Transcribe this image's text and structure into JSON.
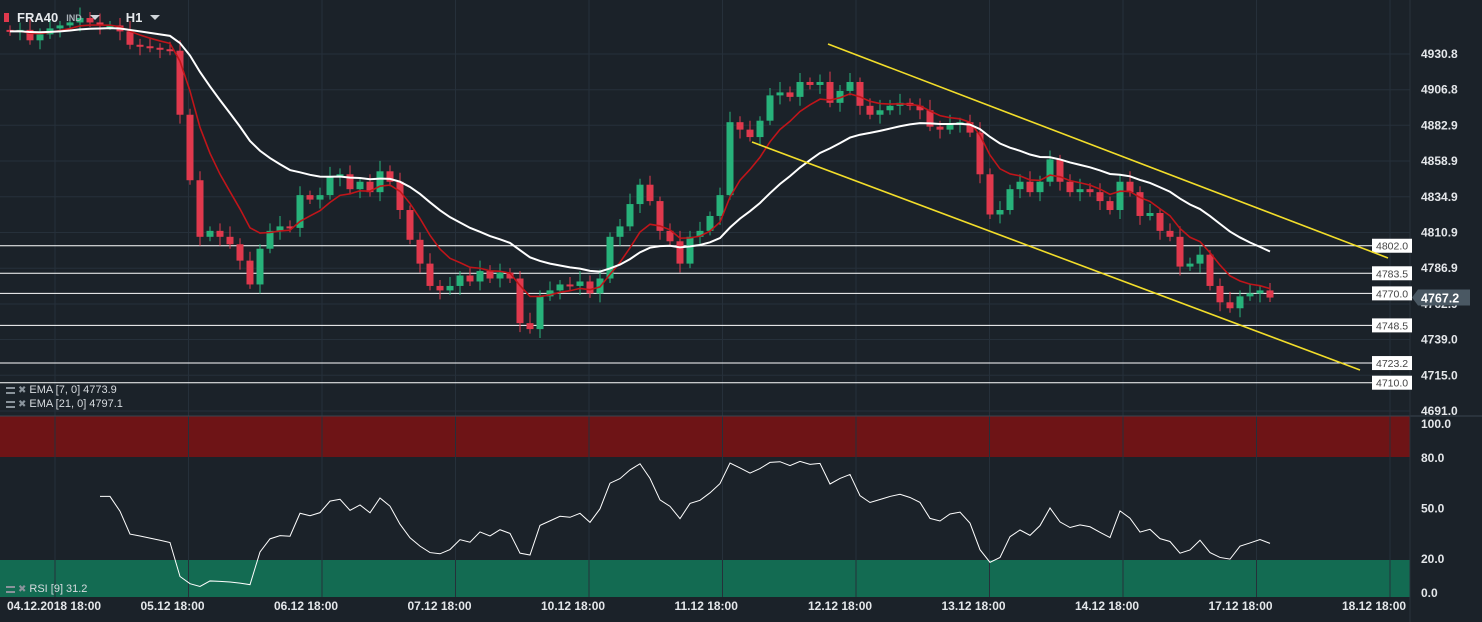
{
  "header": {
    "symbol": "FRA40",
    "type": "IND",
    "timeframe": "H1"
  },
  "indicators": [
    {
      "label": "EMA [7, 0]",
      "value": "4773.9",
      "color": "#c0151a",
      "period": 7
    },
    {
      "label": "EMA [21, 0]",
      "value": "4797.1",
      "color": "#ffffff",
      "period": 21
    }
  ],
  "rsi": {
    "label": "RSI [9]",
    "value": "31.2",
    "period": 9,
    "overbought": 80,
    "oversold": 20
  },
  "colors": {
    "background": "#1b2229",
    "up": "#27b27a",
    "down": "#e0394d",
    "channel": "#f2dd2a",
    "rsi_high": "#6e1416",
    "rsi_low": "#136b52"
  },
  "chart_data": {
    "type": "candlestick",
    "title": "FRA40 H1",
    "ylim": [
      4691.0,
      4940.0
    ],
    "price_ticks": [
      "4930.8",
      "4906.8",
      "4882.9",
      "4858.9",
      "4834.9",
      "4810.9",
      "4786.9",
      "4762.9",
      "4739.0",
      "4715.0",
      "4691.0"
    ],
    "rsi_ticks": [
      "100.0",
      "80.0",
      "50.0",
      "20.0",
      "0.0"
    ],
    "x_ticks": [
      "04.12.2018 18:00",
      "05.12 18:00",
      "06.12 18:00",
      "07.12 18:00",
      "10.12 18:00",
      "11.12 18:00",
      "12.12 18:00",
      "13.12 18:00",
      "14.12 18:00",
      "17.12 18:00",
      "18.12 18:00"
    ],
    "closes": [
      4946,
      4947,
      4940,
      4944,
      4948,
      4950,
      4952,
      4955,
      4952,
      4950,
      4950,
      4946,
      4937,
      4936,
      4935,
      4934,
      4933,
      4890,
      4846,
      4808,
      4812,
      4808,
      4803,
      4792,
      4776,
      4800,
      4812,
      4815,
      4814,
      4836,
      4833,
      4836,
      4848,
      4850,
      4840,
      4845,
      4838,
      4852,
      4845,
      4826,
      4806,
      4790,
      4775,
      4772,
      4775,
      4782,
      4778,
      4785,
      4780,
      4784,
      4780,
      4750,
      4746,
      4768,
      4772,
      4776,
      4775,
      4778,
      4770,
      4780,
      4808,
      4815,
      4830,
      4843,
      4832,
      4812,
      4805,
      4790,
      4808,
      4812,
      4822,
      4836,
      4885,
      4880,
      4875,
      4886,
      4903,
      4905,
      4902,
      4912,
      4910,
      4912,
      4898,
      4906,
      4912,
      4896,
      4890,
      4893,
      4896,
      4898,
      4896,
      4893,
      4882,
      4880,
      4884,
      4885,
      4878,
      4850,
      4823,
      4826,
      4840,
      4845,
      4838,
      4845,
      4860,
      4845,
      4838,
      4840,
      4838,
      4832,
      4826,
      4845,
      4838,
      4822,
      4824,
      4812,
      4808,
      4788,
      4790,
      4796,
      4775,
      4764,
      4760,
      4768,
      4770,
      4772,
      4767.2
    ],
    "current_price": "4767.2",
    "levels": [
      "4802.0",
      "4783.5",
      "4770.0",
      "4748.5",
      "4723.2",
      "4710.0"
    ],
    "channel": {
      "upper": [
        [
          81.8,
          4937.5
        ],
        [
          137.8,
          4793.8
        ]
      ],
      "lower": [
        [
          74.2,
          4871.7
        ],
        [
          135,
          4718.5
        ]
      ]
    }
  }
}
